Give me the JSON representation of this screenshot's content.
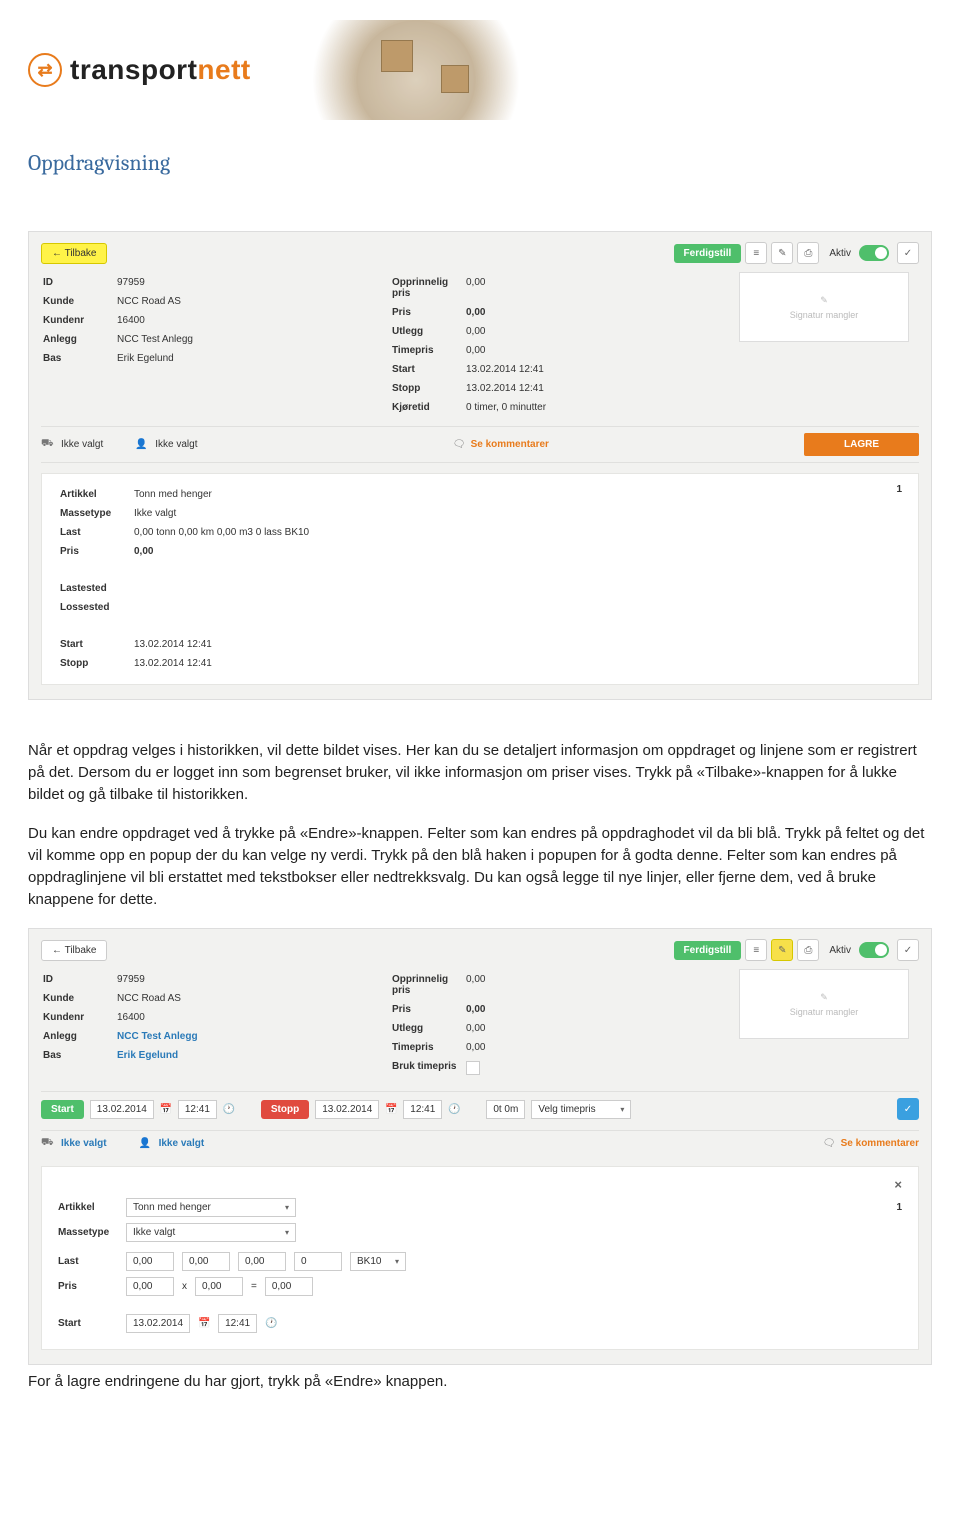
{
  "logo_text1": "transport",
  "logo_text2": "nett",
  "page_title": "Oppdragvisning",
  "para1": "Når et oppdrag velges i historikken, vil dette bildet vises. Her kan du se detaljert informasjon om oppdraget og linjene som er registrert på det. Dersom du er logget inn som begrenset bruker, vil ikke informasjon om priser vises. Trykk på «Tilbake»-knappen for å lukke bildet og gå tilbake til historikken.",
  "para2": "Du kan endre oppdraget ved å trykke på «Endre»-knappen. Felter som kan endres på oppdraghodet vil da bli blå. Trykk på feltet og det vil komme opp en popup der du kan velge ny verdi. Trykk på den blå haken i popupen for å godta denne. Felter som kan endres på oppdraglinjene vil bli erstattet med tekstbokser eller nedtrekksvalg. Du kan også legge til nye linjer, eller fjerne dem, ved å bruke knappene for dette.",
  "footer": "For å lagre endringene du har gjort, trykk på «Endre» knappen.",
  "btn_tilbake": "←  Tilbake",
  "btn_ferdigstill": "Ferdigstill",
  "lbl_aktiv": "Aktiv",
  "sig_missing": "Signatur mangler",
  "ikke_valgt": "Ikke valgt",
  "se_kommentarer": "Se kommentarer",
  "btn_lagre": "LAGRE",
  "ss1": {
    "left": {
      "ID": "97959",
      "Kunde": "NCC Road AS",
      "Kundenr": "16400",
      "Anlegg": "NCC Test Anlegg",
      "Bas": "Erik Egelund"
    },
    "right": {
      "Opprinnelig_pris": "0,00",
      "Pris": "0,00",
      "Utlegg": "0,00",
      "Timepris": "0,00",
      "Start": "13.02.2014   12:41",
      "Stopp": "13.02.2014   12:41",
      "Kjøretid": "0 timer, 0 minutter"
    },
    "detail": {
      "Artikkel": "Tonn med henger",
      "count": "1",
      "Massetype": "Ikke valgt",
      "Last": "0,00 tonn   0,00 km   0,00 m3   0 lass   BK10",
      "Pris": "0,00",
      "Lastested": "",
      "Lossested": "",
      "Start": "13.02.2014   12:41",
      "Stopp": "13.02.2014   12:41"
    }
  },
  "ss2": {
    "left": {
      "ID": "97959",
      "Kunde": "NCC Road AS",
      "Kundenr": "16400",
      "Anlegg": "NCC Test Anlegg",
      "Bas": "Erik Egelund"
    },
    "right": {
      "Opprinnelig_pris": "0,00",
      "Pris": "0,00",
      "Utlegg": "0,00",
      "Timepris": "0,00",
      "Bruk_timepris": ""
    },
    "datebar": {
      "start_label": "Start",
      "start_date": "13.02.2014",
      "start_time": "12:41",
      "stopp_label": "Stopp",
      "stopp_date": "13.02.2014",
      "stopp_time": "12:41",
      "ot0m": "0t 0m",
      "velg_timepris": "Velg timepris"
    },
    "card": {
      "Artikkel": "Tonn med henger",
      "count": "1",
      "Massetype": "Ikke valgt",
      "last_vals": [
        "0,00",
        "0,00",
        "0,00",
        "0",
        "BK10"
      ],
      "pris_vals": [
        "0,00",
        "0,00",
        "0,00"
      ],
      "pris_ops": [
        "x",
        "="
      ],
      "start_date": "13.02.2014",
      "start_time": "12:41"
    },
    "labels": {
      "Artikkel": "Artikkel",
      "Massetype": "Massetype",
      "Last": "Last",
      "Pris": "Pris",
      "Start": "Start"
    }
  },
  "labels": {
    "ID": "ID",
    "Kunde": "Kunde",
    "Kundenr": "Kundenr",
    "Anlegg": "Anlegg",
    "Bas": "Bas",
    "Opprinnelig_pris": "Opprinnelig pris",
    "Pris": "Pris",
    "Utlegg": "Utlegg",
    "Timepris": "Timepris",
    "Start": "Start",
    "Stopp": "Stopp",
    "Kjøretid": "Kjøretid",
    "Bruk_timepris": "Bruk timepris",
    "Artikkel": "Artikkel",
    "Massetype": "Massetype",
    "Last": "Last",
    "Lastested": "Lastested",
    "Lossested": "Lossested"
  }
}
